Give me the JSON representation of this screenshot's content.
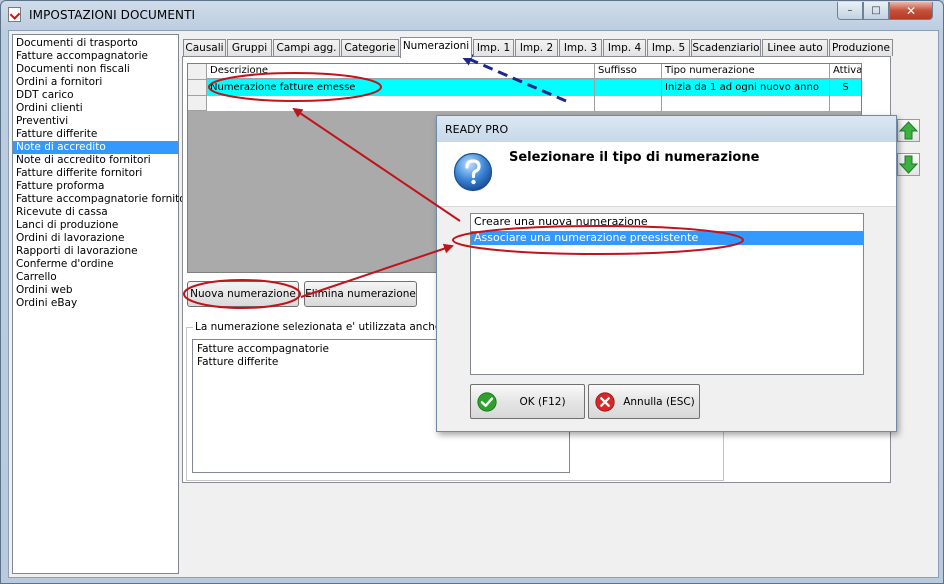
{
  "window": {
    "title": "IMPOSTAZIONI DOCUMENTI",
    "minimize_glyph": "–",
    "maximize_glyph": "□",
    "close_glyph": "✕"
  },
  "documents": {
    "selected_index": 8,
    "items": [
      "Documenti di trasporto",
      "Fatture accompagnatorie",
      "Documenti non fiscali",
      "Ordini a fornitori",
      "DDT carico",
      "Ordini clienti",
      "Preventivi",
      "Fatture differite",
      "Note di accredito",
      "Note di accredito fornitori",
      "Fatture differite fornitori",
      "Fatture proforma",
      "Fatture accompagnatorie fornitori",
      "Ricevute di cassa",
      "Lanci di produzione",
      "Ordini di lavorazione",
      "Rapporti di lavorazione",
      "Conferme d'ordine",
      "Carrello",
      "Ordini web",
      "Ordini eBay"
    ]
  },
  "tabs": {
    "active": "Numerazioni",
    "items": [
      "Causali",
      "Gruppi",
      "Campi agg.",
      "Categorie",
      "Numerazioni",
      "Imp. 1",
      "Imp. 2",
      "Imp. 3",
      "Imp. 4",
      "Imp. 5",
      "Scadenziario",
      "Linee auto",
      "Produzione"
    ]
  },
  "grid": {
    "columns": [
      "Descrizione",
      "Suffisso",
      "Tipo numerazione",
      "Attiva"
    ],
    "rows": [
      {
        "descrizione": "Numerazione fatture emesse",
        "suffisso": "",
        "tipo": "Inizia da 1 ad ogni nuovo anno",
        "attiva": "S"
      }
    ]
  },
  "buttons": {
    "new_numbering": "Nuova numerazione",
    "delete_numbering": "Elimina numerazione"
  },
  "usage": {
    "label": "La numerazione selezionata e' utilizzata anche per",
    "items": [
      "Fatture accompagnatorie",
      "Fatture differite"
    ]
  },
  "dialog": {
    "title": "READY PRO",
    "question": "Selezionare il tipo di numerazione",
    "selected_index": 1,
    "options": [
      "Creare una nuova numerazione",
      "Associare una numerazione preesistente"
    ],
    "ok_label": "OK (F12)",
    "cancel_label": "Annulla (ESC)"
  },
  "colors": {
    "selection": "#3399ff",
    "grid_row": "#00ffff",
    "annotation_red": "#c0141c",
    "annotation_blue": "#1a2a8c",
    "ok_green": "#2ea02e",
    "cancel_red": "#d62828",
    "arrow_green": "#3cb043"
  }
}
